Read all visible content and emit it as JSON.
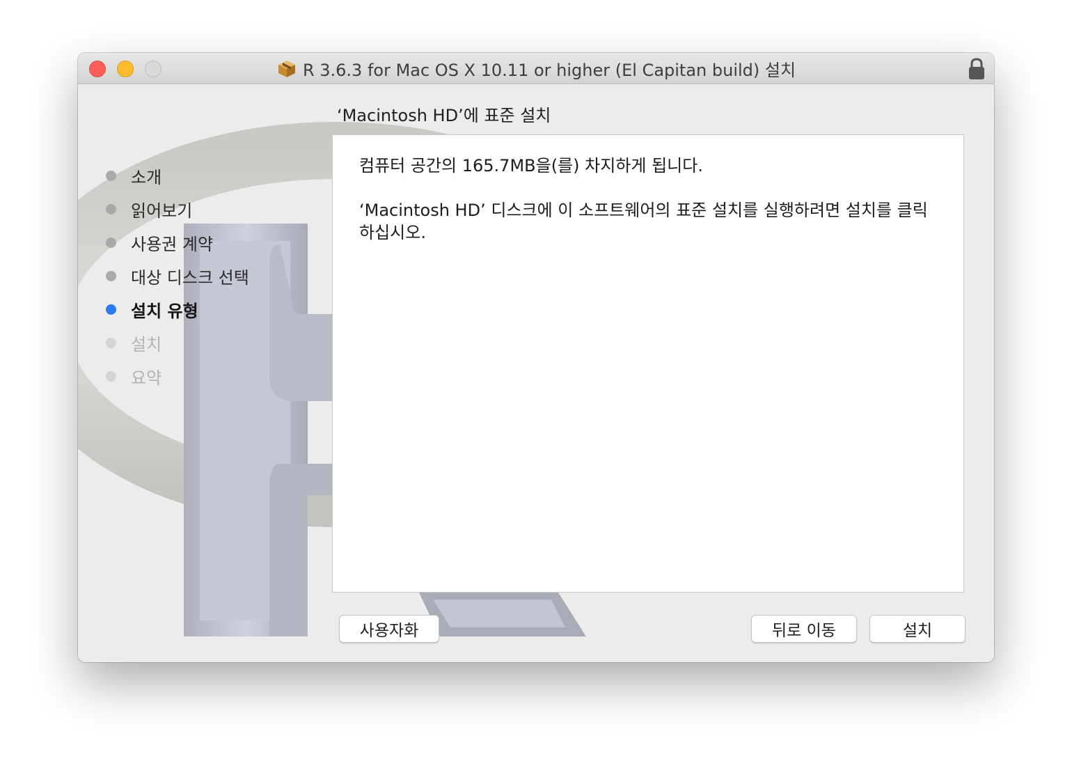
{
  "window": {
    "title": "R 3.6.3 for Mac OS X 10.11 or higher (El Capitan build) 설치"
  },
  "icons": {
    "package": "package-icon",
    "lock": "lock-icon",
    "background": "r-logo-watermark"
  },
  "section_title": "‘Macintosh HD’에 표준 설치",
  "steps": [
    {
      "label": "소개",
      "state": "done"
    },
    {
      "label": "읽어보기",
      "state": "done"
    },
    {
      "label": "사용권 계약",
      "state": "done"
    },
    {
      "label": "대상 디스크 선택",
      "state": "done"
    },
    {
      "label": "설치 유형",
      "state": "current"
    },
    {
      "label": "설치",
      "state": "pending"
    },
    {
      "label": "요약",
      "state": "pending"
    }
  ],
  "content": {
    "line1": "컴퓨터 공간의 165.7MB을(를) 차지하게 됩니다.",
    "line2": "‘Macintosh HD’ 디스크에 이 소프트웨어의 표준 설치를 실행하려면 설치를 클릭하십시오."
  },
  "buttons": {
    "customize": "사용자화",
    "back": "뒤로 이동",
    "install": "설치"
  },
  "colors": {
    "current_step": "#2d7bf0",
    "close": "#fc5f57",
    "minimize": "#fdbc2e"
  }
}
